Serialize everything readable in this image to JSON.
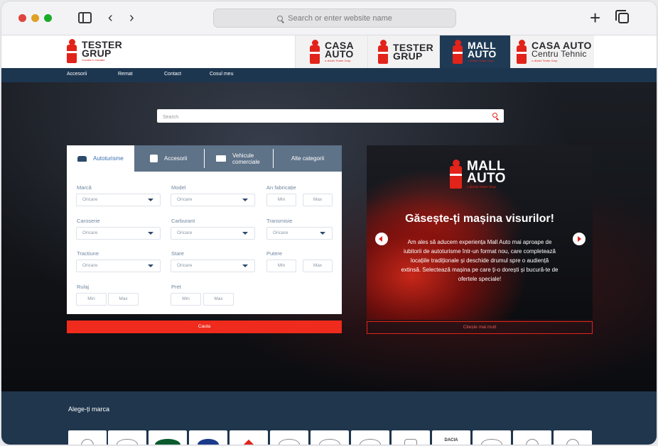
{
  "browser": {
    "url_placeholder": "Search or enter website name"
  },
  "header": {
    "main_logo": {
      "line1": "TESTER",
      "line2": "GRUP",
      "sub": "Vocația în inovație"
    },
    "brand_tabs": [
      {
        "line1": "CASA",
        "line2": "AUTO",
        "sub": "o divizie Tester Grup",
        "active": false
      },
      {
        "line1": "TESTER",
        "line2": "GRUP",
        "sub": "",
        "active": false
      },
      {
        "line1": "MALL",
        "line2": "AUTO",
        "sub": "o divizie Tester Grup",
        "active": true
      },
      {
        "line1": "CASA AUTO",
        "line2": "Centru Tehnic",
        "sub": "o divizie Tester Grup",
        "active": false
      }
    ]
  },
  "nav": {
    "items": [
      "Accesorii",
      "Remat",
      "Contact",
      "Cosul meu"
    ]
  },
  "hero": {
    "search_placeholder": "Search"
  },
  "filter": {
    "tabs": [
      "Autoturisme",
      "Accesorii",
      "Vehicule\ncomerciale",
      "Alte categorii"
    ],
    "labels": {
      "marca": "Marcă",
      "model": "Model",
      "an": "An fabricație",
      "caroserie": "Caroserie",
      "carburant": "Carburant",
      "transmisie": "Transmisie",
      "tractiune": "Tractiune",
      "stare": "Stare",
      "putere": "Putere",
      "rulaj": "Rulaj",
      "pret": "Pret"
    },
    "select_value": "Oricare",
    "min": "Min",
    "max": "Max",
    "search_button": "Cauta"
  },
  "promo": {
    "logo": {
      "line1": "MALL",
      "line2": "AUTO",
      "sub": "o divizie Tester Grup"
    },
    "title": "Găsește-ți mașina visurilor!",
    "text": "Am ales să aducem experiența Mall Auto mai aproape de iubitorii de autoturisme într-un format nou, care completează locațiile tradiționale și deschide drumul spre o audiență extinsă. Selectează mașina pe care ți-o dorești și bucură-te de ofertele speciale!",
    "read_more": "Citește mai mult"
  },
  "brands": {
    "title": "Alege-ți marca",
    "tiles": [
      {
        "icon": "mercedes-logo-icon"
      },
      {
        "icon": "jaguar-logo-icon"
      },
      {
        "icon": "land-rover-logo-icon",
        "label": "LAND ROVER"
      },
      {
        "icon": "hyundai-logo-icon"
      },
      {
        "icon": "renault-logo-icon"
      },
      {
        "icon": "opel-logo-icon"
      },
      {
        "icon": "infiniti-logo-icon"
      },
      {
        "icon": "mazda-logo-icon"
      },
      {
        "icon": "honda-logo-icon"
      },
      {
        "icon": "dacia-logo-icon",
        "label": "DACIA"
      },
      {
        "icon": "citroen-logo-icon"
      },
      {
        "icon": "peugeot-logo-icon"
      },
      {
        "icon": "alfa-romeo-logo-icon"
      }
    ]
  },
  "colors": {
    "brand_red": "#e2231a",
    "navy": "#1d3650",
    "tab_gray": "#5e7288"
  }
}
